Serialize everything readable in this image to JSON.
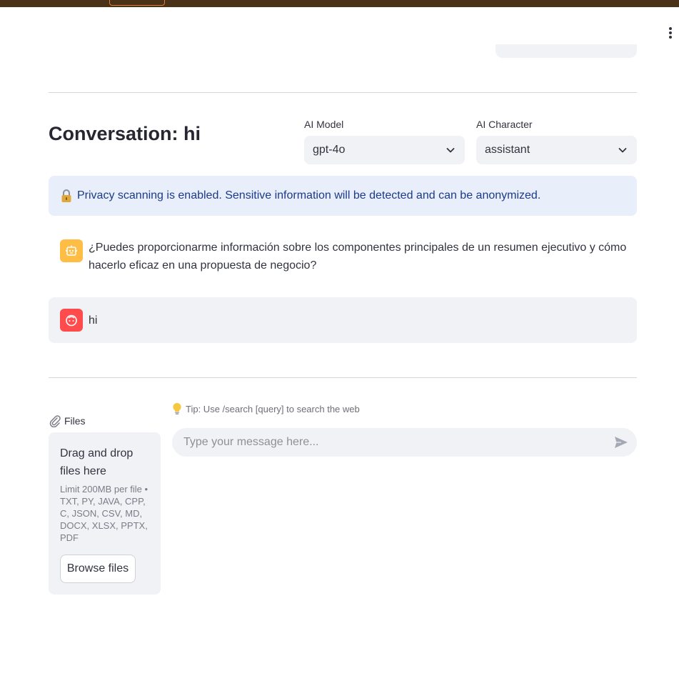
{
  "conversation": {
    "title": "Conversation: hi"
  },
  "model_select": {
    "label": "AI Model",
    "value": "gpt-4o"
  },
  "character_select": {
    "label": "AI Character",
    "value": "assistant"
  },
  "privacy_banner": {
    "text": "Privacy scanning is enabled. Sensitive information will be detected and can be anonymized."
  },
  "messages": [
    {
      "role": "assistant",
      "icon": "robot-icon",
      "text": "¿Puedes proporcionarme información sobre los componentes principales de un resumen ejecutivo y cómo hacerlo eficaz en una propuesta de negocio?"
    },
    {
      "role": "user",
      "icon": "user-face-icon",
      "text": "hi"
    }
  ],
  "uploader": {
    "label": "Files",
    "drop_text": "Drag and drop files here",
    "limit_text": "Limit 200MB per file • TXT, PY, JAVA, CPP, C, JSON, CSV, MD, DOCX, XLSX, PPTX, PDF",
    "browse_label": "Browse files"
  },
  "tip": {
    "text": "Tip: Use /search [query] to search the web"
  },
  "chat_input": {
    "placeholder": "Type your message here..."
  },
  "colors": {
    "assistant_avatar": "#ffbd45",
    "user_avatar": "#ff4b4b",
    "info_bg": "#e8eefa",
    "info_text": "#1c3a8a",
    "topbar": "#4a3218"
  }
}
